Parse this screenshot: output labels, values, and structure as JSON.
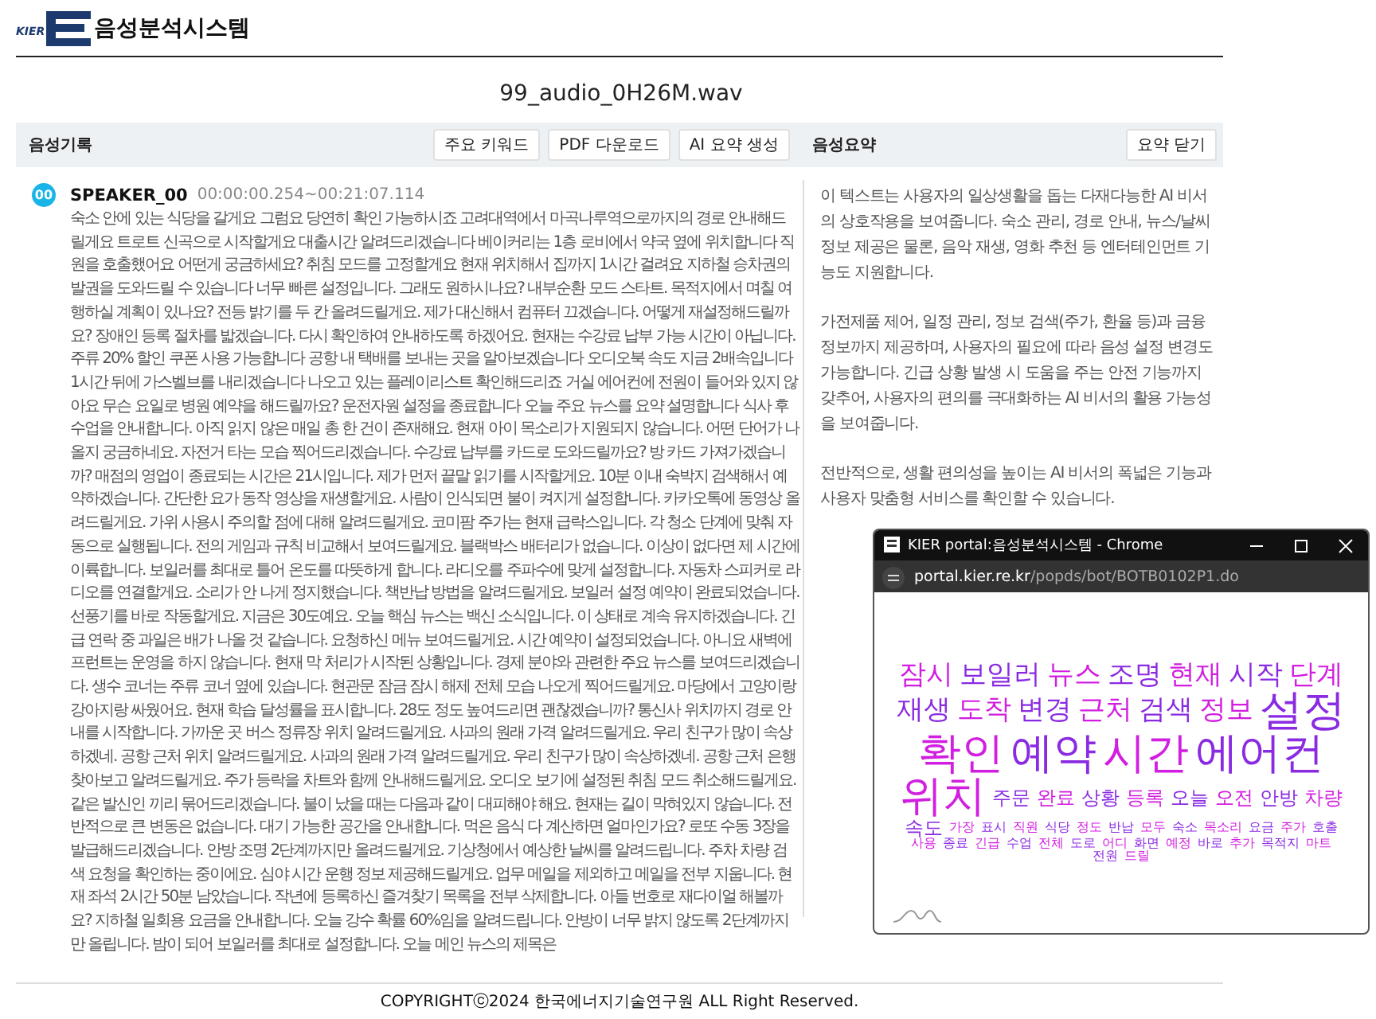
{
  "header": {
    "logo_text": "KIER",
    "title": "음성분석시스템"
  },
  "file_name": "99_audio_0H26M.wav",
  "toolbar": {
    "left_label": "음성기록",
    "buttons": [
      "주요 키워드",
      "PDF 다운로드",
      "AI 요약 생성"
    ],
    "right_label": "음성요약",
    "close_button": "요약 닫기"
  },
  "transcript": [
    {
      "badge": "00",
      "speaker": "SPEAKER_00",
      "time": "00:00:00.254~00:21:07.114",
      "text": "숙소 안에 있는 식당을 갈게요 그럼요 당연히 확인 가능하시죠 고려대역에서 마곡나루역으로까지의 경로 안내해드릴게요 트로트 신곡으로 시작할게요 대출시간 알려드리겠습니다 베이커리는 1층 로비에서 약국 옆에 위치합니다 직원을 호출했어요 어떤게 궁금하세요? 취침 모드를 고정할게요 현재 위치해서 집까지 1시간 걸려요 지하철 승차권의 발권을 도와드릴 수 있습니다 너무 빠른 설정입니다. 그래도 원하시나요? 내부순환 모드 스타트. 목적지에서 며칠 여행하실 계획이 있나요? 전등 밝기를 두 칸 올려드릴게요. 제가 대신해서 컴퓨터 끄겠습니다. 어떻게 재설정해드릴까요? 장애인 등록 절차를 밟겠습니다. 다시 확인하여 안내하도록 하겠어요. 현재는 수강료 납부 가능 시간이 아닙니다. 주류 20% 할인 쿠폰 사용 가능합니다 공항 내 택배를 보내는 곳을 알아보겠습니다 오디오북 속도 지금 2배속입니다 1시간 뒤에 가스벨브를 내리겠습니다 나오고 있는 플레이리스트 확인해드리죠 거실 에어컨에 전원이 들어와 있지 않아요 무슨 요일로 병원 예약을 해드릴까요? 운전자원 설정을 종료합니다 오늘 주요 뉴스를 요약 설명합니다 식사 후 수업을 안내합니다. 아직 읽지 않은 매일 총 한 건이 존재해요. 현재 아이 목소리가 지원되지 않습니다. 어떤 단어가 나올지 궁금하네요. 자전거 타는 모습 찍어드리겠습니다. 수강료 납부를 카드로 도와드릴까요? 방 카드 가져가겠습니까? 매점의 영업이 종료되는 시간은 21시입니다. 제가 먼저 끝말 읽기를 시작할게요. 10분 이내 숙박지 검색해서 예약하겠습니다. 간단한 요가 동작 영상을 재생할게요. 사람이 인식되면 불이 켜지게 설정합니다. 카카오톡에 동영상 올려드릴게요. 가위 사용시 주의할 점에 대해 알려드릴게요. 코미팜 주가는 현재 급락스입니다. 각 청소 단계에 맞춰 자동으로 실행됩니다. 전의 게임과 규칙 비교해서 보여드릴게요. 블랙박스 배터리가 없습니다. 이상이 없다면 제 시간에 이륙합니다. 보일러를 최대로 틀어 온도를 따뜻하게 합니다. 라디오를 주파수에 맞게 설정합니다. 자동차 스피커로 라디오를 연결할게요. 소리가 안 나게 정지했습니다. 책반납 방법을 알려드릴게요. 보일러 설정 예약이 완료되었습니다. 선풍기를 바로 작동할게요. 지금은 30도예요. 오늘 핵심 뉴스는 백신 소식입니다. 이 상태로 계속 유지하겠습니다. 긴급 연락 중 과일은 배가 나올 것 같습니다. 요청하신 메뉴 보여드릴게요. 시간 예약이 설정되었습니다. 아니요 새벽에 프런트는 운영을 하지 않습니다. 현재 막 처리가 시작된 상황입니다. 경제 분야와 관련한 주요 뉴스를 보여드리겠습니다. 생수 코너는 주류 코너 옆에 있습니다. 현관문 잠금 잠시 해제 전체 모습 나오게 찍어드릴게요. 마당에서 고양이랑 강아지랑 싸웠어요. 현재 학습 달성률을 표시합니다. 28도 정도 높여드리면 괜찮겠습니까? 통신사 위치까지 경로 안내를 시작합니다. 가까운 곳 버스 정류장 위치 알려드릴게요. 사과의 원래 가격 알려드릴게요. 우리 친구가 많이 속상하겠네. 공항 근처 위치 알려드릴게요. 사과의 원래 가격 알려드릴게요. 우리 친구가 많이 속상하겠네. 공항 근처 은행 찾아보고 알려드릴게요. 주가 등락을 차트와 함께 안내해드릴게요. 오디오 보기에 설정된 취침 모드 취소해드릴게요. 같은 발신인 끼리 묶어드리겠습니다. 불이 났을 때는 다음과 같이 대피해야 해요. 현재는 길이 막혀있지 않습니다. 전반적으로 큰 변동은 없습니다. 대기 가능한 공간을 안내합니다. 먹은 음식 다 계산하면 얼마인가요? 로또 수동 3장을 발급해드리겠습니다. 안방 조명 2단계까지만 올려드릴게요. 기상청에서 예상한 날씨를 알려드립니다. 주차 차량 검색 요청을 확인하는 중이에요. 심야 시간 운행 정보 제공해드릴게요. 업무 메일을 제외하고 메일을 전부 지웁니다. 현재 좌석 2시간 50분 남았습니다. 작년에 등록하신 즐겨찾기 목록을 전부 삭제합니다. 아들 번호로 재다이얼 해볼까요? 지하철 일회용 요금을 안내합니다. 오늘 강수 확률 60%임을 알려드립니다. 안방이 너무 밝지 않도록 2단계까지만 올립니다. 밤이 되어 보일러를 최대로 설정합니다. 오늘 메인 뉴스의 제목은"
    }
  ],
  "summary": [
    "이 텍스트는 사용자의 일상생활을 돕는 다재다능한 AI 비서의 상호작용을 보여줍니다. 숙소 관리, 경로 안내, 뉴스/날씨 정보 제공은 물론, 음악 재생, 영화 추천 등 엔터테인먼트 기능도 지원합니다.",
    "가전제품 제어, 일정 관리, 정보 검색(주가, 환율 등)과 금융 정보까지 제공하며, 사용자의 필요에 따라 음성 설정 변경도 가능합니다. 긴급 상황 발생 시 도움을 주는 안전 기능까지 갖추어, 사용자의 편의를 극대화하는 AI 비서의 활용 가능성을 보여줍니다.",
    "전반적으로, 생활 편의성을 높이는 AI 비서의 폭넓은 기능과 사용자 맞춤형 서비스를 확인할 수 있습니다."
  ],
  "popup": {
    "title": "KIER portal:음성분석시스템 - Chrome",
    "url_host": "portal.kier.re.kr",
    "url_path": "/popds/bot/BOTB0102P1.do",
    "words": [
      "잠시",
      "보일러",
      "뉴스",
      "조명",
      "현재",
      "시작",
      "단계",
      "재생",
      "도착",
      "변경",
      "근처",
      "검색",
      "정보",
      "설정",
      "확인",
      "예약",
      "시간",
      "에어컨",
      "위치",
      "주문",
      "완료",
      "상황",
      "등록",
      "오늘",
      "오전",
      "안방",
      "차량",
      "속도",
      "가장",
      "표시",
      "직원",
      "식당",
      "정도",
      "반납",
      "모두",
      "숙소",
      "목소리",
      "요금",
      "주가",
      "호출",
      "사용",
      "종료",
      "긴급",
      "수업",
      "전체",
      "도로",
      "어디",
      "화면",
      "예정",
      "바로",
      "추가",
      "목적지",
      "마트",
      "전원",
      "드릴"
    ]
  },
  "footer": "COPYRIGHTⓒ2024 한국에너지기술연구원 ALL Right Reserved."
}
